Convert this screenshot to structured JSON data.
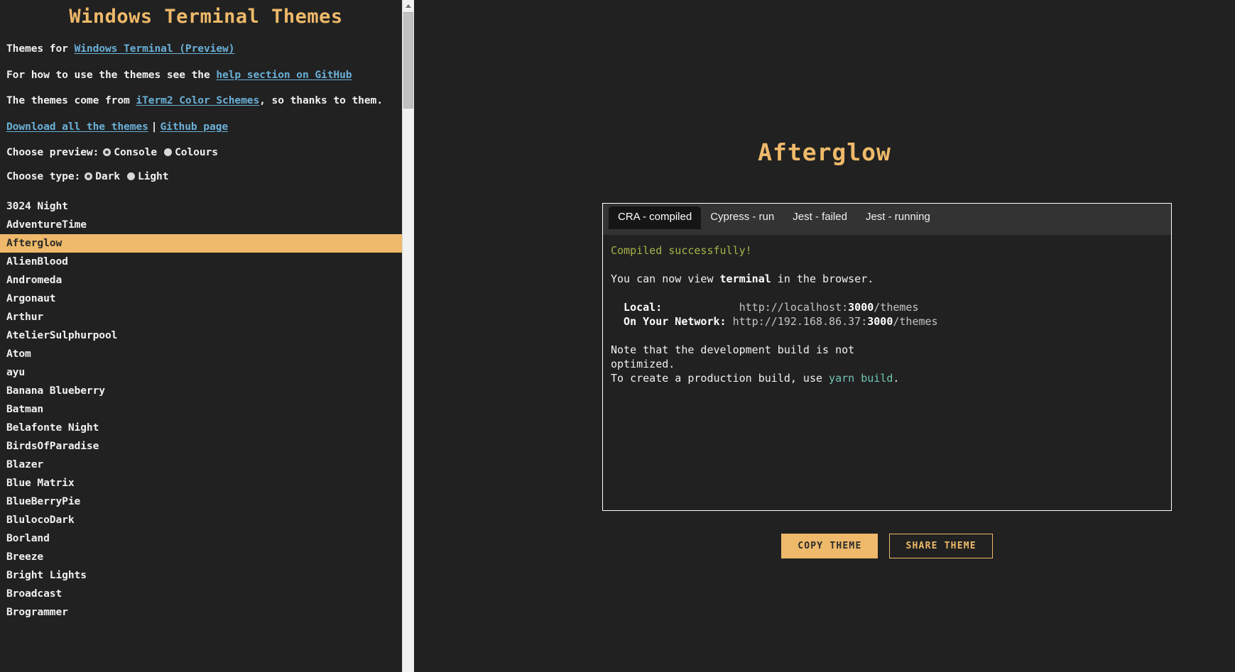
{
  "site": {
    "title": "Windows Terminal Themes",
    "intro_lines": [
      {
        "prefix": "Themes for ",
        "link": "Windows Terminal (Preview)",
        "suffix": ""
      },
      {
        "prefix": "For how to use the themes see the ",
        "link": "help section on GitHub",
        "suffix": ""
      },
      {
        "prefix": "The themes come from ",
        "link": "iTerm2 Color Schemes",
        "suffix": ", so thanks to them."
      }
    ],
    "download_link": "Download all the themes",
    "separator": "|",
    "github_link": "Github page"
  },
  "controls": {
    "preview_label": "Choose preview:",
    "preview_options": [
      "Console",
      "Colours"
    ],
    "preview_selected": "Console",
    "type_label": "Choose type:",
    "type_options": [
      "Dark",
      "Light"
    ],
    "type_selected": "Dark"
  },
  "theme_list": {
    "selected": "Afterglow",
    "items": [
      "3024 Night",
      "AdventureTime",
      "Afterglow",
      "AlienBlood",
      "Andromeda",
      "Argonaut",
      "Arthur",
      "AtelierSulphurpool",
      "Atom",
      "ayu",
      "Banana Blueberry",
      "Batman",
      "Belafonte Night",
      "BirdsOfParadise",
      "Blazer",
      "Blue Matrix",
      "BlueBerryPie",
      "BlulocoDark",
      "Borland",
      "Breeze",
      "Bright Lights",
      "Broadcast",
      "Brogrammer"
    ]
  },
  "preview": {
    "title": "Afterglow",
    "tabs": [
      {
        "label": "CRA - compiled",
        "active": true
      },
      {
        "label": "Cypress - run",
        "active": false
      },
      {
        "label": "Jest - failed",
        "active": false
      },
      {
        "label": "Jest - running",
        "active": false
      }
    ],
    "terminal": {
      "compiled": "Compiled successfully!",
      "view_prefix": "You can now view ",
      "view_bold": "terminal",
      "view_suffix": " in the browser.",
      "local_label": "  Local:",
      "local_pad": "            ",
      "local_url_a": "http://localhost:",
      "local_port": "3000",
      "local_url_b": "/themes",
      "network_label": "  On Your Network:",
      "network_pad": " ",
      "network_url_a": "http://192.168.86.37:",
      "network_port": "3000",
      "network_url_b": "/themes",
      "note_line1": "Note that the development build is not",
      "note_line2": "optimized.",
      "prod_prefix": "To create a production build, use ",
      "prod_cmd": "yarn build",
      "prod_suffix": "."
    }
  },
  "buttons": {
    "copy": "COPY THEME",
    "share": "SHARE THEME"
  },
  "colors": {
    "background": "#212121",
    "accent": "#eeb96a",
    "link": "#6ab0d8",
    "tabbar": "#333333",
    "terminal_green": "#a6b34a",
    "terminal_cyan": "#71c6b1"
  }
}
